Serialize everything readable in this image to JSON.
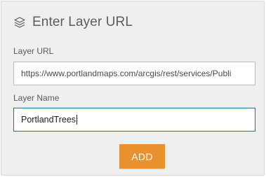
{
  "header": {
    "icon": "layers-icon",
    "title": "Enter Layer URL"
  },
  "form": {
    "url_label": "Layer URL",
    "url_value": "https://www.portlandmaps.com/arcgis/rest/services/Publi",
    "name_label": "Layer Name",
    "name_value": "PortlandTrees",
    "add_label": "ADD"
  },
  "colors": {
    "accent": "#e9902f",
    "focus_border": "#2f6c98",
    "panel_bg": "#efefef"
  }
}
